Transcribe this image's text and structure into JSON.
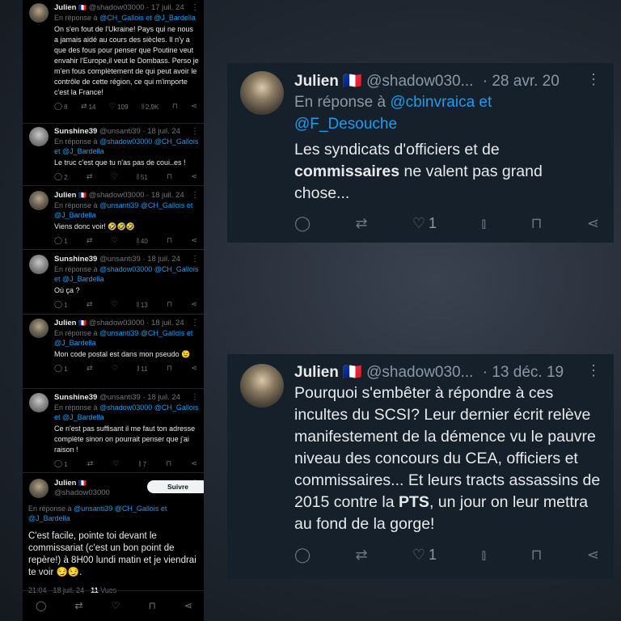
{
  "left_thread": {
    "tweets": [
      {
        "name": "Julien",
        "flag": "🇫🇷",
        "handle": "@shadow03000",
        "date": "· 17 juil. 24",
        "reply_prefix": "En réponse à",
        "reply_to": "@CH_Gallois et @J_Bardella",
        "text": "On s'en fout de l'Ukraine! Pays qui ne nous a jamais aidé au cours des siècles. Il n'y a que des fous pour penser que Poutine veut envahir l'Europe,il veut le Dombass. Perso je m'en fous complètement de qui peut avoir le contrôle de cette région, ce qui m'importe c'est la France!",
        "replies": "8",
        "retweets": "14",
        "likes": "109",
        "views": "2,9K"
      },
      {
        "name": "Sunshine39",
        "handle": "@unsanti39",
        "date": "· 18 juil. 24",
        "reply_prefix": "En réponse à",
        "reply_to": "@shadow03000 @CH_Gallois et @J_Bardella",
        "text": "Le truc c'est que tu n'as pas de coui..es !",
        "replies": "2",
        "retweets": "",
        "likes": "",
        "views": "51"
      },
      {
        "name": "Julien",
        "flag": "🇫🇷",
        "handle": "@shadow03000",
        "date": "· 18 juil. 24",
        "reply_prefix": "En réponse à",
        "reply_to": "@unsanti39 @CH_Gallois et @J_Bardella",
        "text": "Viens donc voir! 🤣🤣🤣",
        "replies": "1",
        "retweets": "",
        "likes": "",
        "views": "40"
      },
      {
        "name": "Sunshine39",
        "handle": "@unsanti39",
        "date": "· 18 juil. 24",
        "reply_prefix": "En réponse à",
        "reply_to": "@shadow03000 @CH_Gallois et @J_Bardella",
        "text": "Où ça ?",
        "replies": "1",
        "retweets": "",
        "likes": "",
        "views": "13"
      },
      {
        "name": "Julien",
        "flag": "🇫🇷",
        "handle": "@shadow03000",
        "date": "· 18 juil. 24",
        "reply_prefix": "En réponse à",
        "reply_to": "@unsanti39 @CH_Gallois et @J_Bardella",
        "text": "Mon code postal est dans mon pseudo 😉",
        "replies": "1",
        "retweets": "",
        "likes": "",
        "views": "11"
      },
      {
        "name": "Sunshine39",
        "handle": "@unsanti39",
        "date": "· 18 juil. 24",
        "reply_prefix": "En réponse à",
        "reply_to": "@shadow03000 @CH_Gallois et @J_Bardella",
        "text": "Ce n'est pas suffisant il me faut ton adresse complète sinon on pourrait penser que j'ai raison !",
        "replies": "1",
        "retweets": "",
        "likes": "",
        "views": "7"
      }
    ],
    "main_tweet": {
      "name": "Julien",
      "flag": "🇫🇷",
      "handle": "@shadow03000",
      "follow_label": "Suivre",
      "reply_prefix": "En réponse à",
      "reply_to": "@unsanti39 @CH_Gallois et @J_Bardella",
      "text": "C'est facile, pointe toi devant le commissariat (c'est un bon point de repère!) à 8H00 lundi matin et je viendrai te voir 😏😏.",
      "meta_time": "21:04 · 18 juil. 24 ·",
      "meta_views": "11",
      "meta_views_label": "Vues"
    }
  },
  "card_top": {
    "name": "Julien",
    "flag": "🇫🇷",
    "handle": "@shadow030...",
    "date": "· 28 avr. 20",
    "reply_prefix": "En réponse à",
    "reply_to_1": "@cbinvraica et",
    "reply_to_2": "@F_Desouche",
    "text_before": "Les syndicats d'officiers et de",
    "text_bold": "commissaires",
    "text_after": "ne valent pas grand chose...",
    "likes": "1"
  },
  "card_bottom": {
    "name": "Julien",
    "flag": "🇫🇷",
    "handle": "@shadow030...",
    "date": "· 13 déc. 19",
    "text_before": "Pourquoi s'embêter à répondre à ces incultes du SCSI? Leur dernier écrit relève manifestement de la démence vu le pauvre niveau des concours du CEA, officiers et commissaires... Et leurs tracts assassins de 2015 contre la",
    "text_bold": "PTS",
    "text_after": ", un jour on leur mettra au fond de la gorge!",
    "likes": "1"
  },
  "icons": {
    "reply": "💬",
    "retweet": "⇄",
    "like": "♡",
    "views": "▮",
    "bookmark": "⚑",
    "share": "⋖"
  }
}
